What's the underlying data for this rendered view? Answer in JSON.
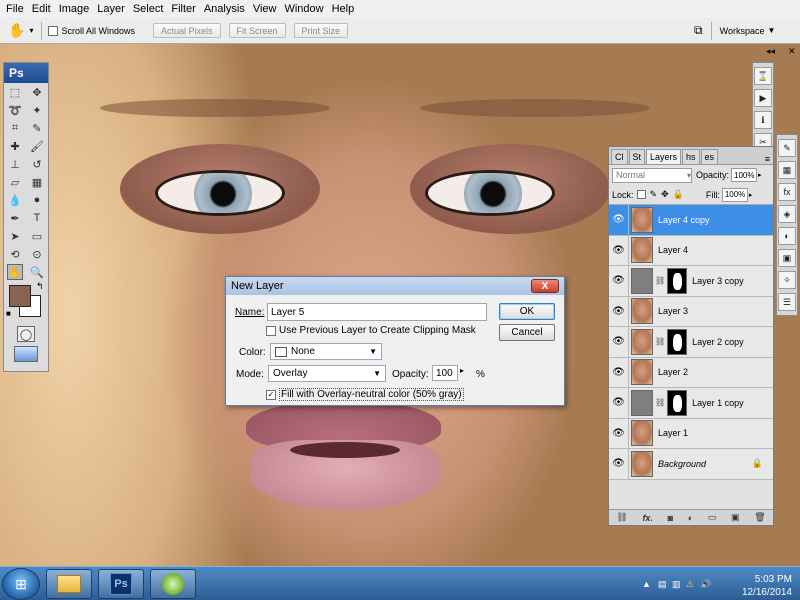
{
  "menu": [
    "File",
    "Edit",
    "Image",
    "Layer",
    "Select",
    "Filter",
    "Analysis",
    "View",
    "Window",
    "Help"
  ],
  "options_bar": {
    "scroll_all_windows": "Scroll All Windows",
    "actual_pixels": "Actual Pixels",
    "fit_screen": "Fit Screen",
    "print_size": "Print Size",
    "workspace": "Workspace"
  },
  "tools": {
    "logo": "Ps"
  },
  "layers_panel": {
    "tabs": [
      "Cl",
      "St",
      "Layers",
      "hs",
      "es"
    ],
    "active_tab": "Layers",
    "blend_mode": "Normal",
    "opacity_label": "Opacity:",
    "opacity_value": "100%",
    "lock_label": "Lock:",
    "fill_label": "Fill:",
    "fill_value": "100%",
    "layers": [
      {
        "name": "Layer 4 copy",
        "selected": true,
        "type": "photo"
      },
      {
        "name": "Layer 4",
        "selected": false,
        "type": "photo"
      },
      {
        "name": "Layer 3 copy",
        "selected": false,
        "type": "gray-mask"
      },
      {
        "name": "Layer 3",
        "selected": false,
        "type": "photo"
      },
      {
        "name": "Layer 2 copy",
        "selected": false,
        "type": "photo-mask"
      },
      {
        "name": "Layer 2",
        "selected": false,
        "type": "photo"
      },
      {
        "name": "Layer 1 copy",
        "selected": false,
        "type": "gray-mask"
      },
      {
        "name": "Layer 1",
        "selected": false,
        "type": "photo"
      },
      {
        "name": "Background",
        "selected": false,
        "type": "photo-locked"
      }
    ],
    "bottom_icons": [
      "link-icon",
      "fx-icon",
      "mask-icon",
      "adjustment-icon",
      "group-icon",
      "new-layer-icon",
      "trash-icon"
    ]
  },
  "dialog": {
    "title": "New Layer",
    "name_label": "Name:",
    "name_value": "Layer 5",
    "clipping_label": "Use Previous Layer to Create Clipping Mask",
    "color_label": "Color:",
    "color_value": "None",
    "mode_label": "Mode:",
    "mode_value": "Overlay",
    "opacity_label": "Opacity:",
    "opacity_value": "100",
    "opacity_unit": "%",
    "fill_label": "Fill with Overlay-neutral color (50% gray)",
    "ok": "OK",
    "cancel": "Cancel",
    "close": "X"
  },
  "taskbar": {
    "time": "5:03 PM",
    "date": "12/16/2014",
    "ps_label": "Ps"
  },
  "colors": {
    "foreground": "#8a6253",
    "background": "#ffffff",
    "selection": "#3d8ee6"
  }
}
